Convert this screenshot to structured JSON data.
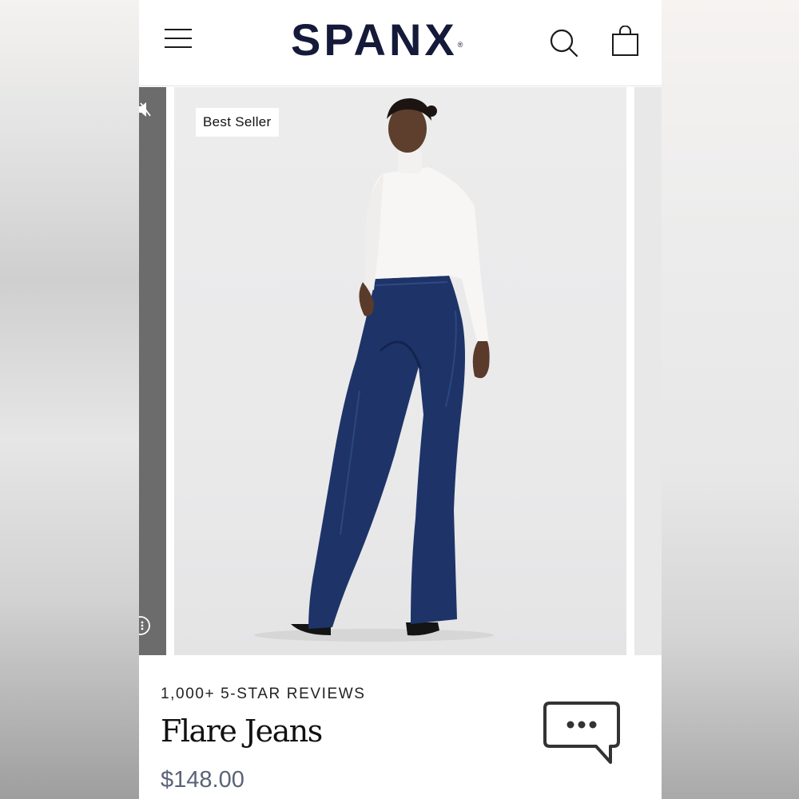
{
  "header": {
    "brand": "SPANX",
    "brand_mark": "®",
    "icons": {
      "menu": "hamburger-menu-icon",
      "search": "search-icon",
      "cart": "shopping-bag-icon"
    }
  },
  "carousel": {
    "badge": "Best Seller",
    "prev_slide_icons": [
      "muted-speaker-icon",
      "more-options-icon"
    ]
  },
  "product": {
    "reviews": "1,000+ 5-STAR REVIEWS",
    "title": "Flare Jeans",
    "price": "$148.00"
  },
  "chat": {
    "icon": "chat-bubble-icon"
  },
  "colors": {
    "brand_navy": "#151a3a",
    "denim": "#1e3468",
    "price": "#5b6378",
    "background": "#ececed"
  }
}
